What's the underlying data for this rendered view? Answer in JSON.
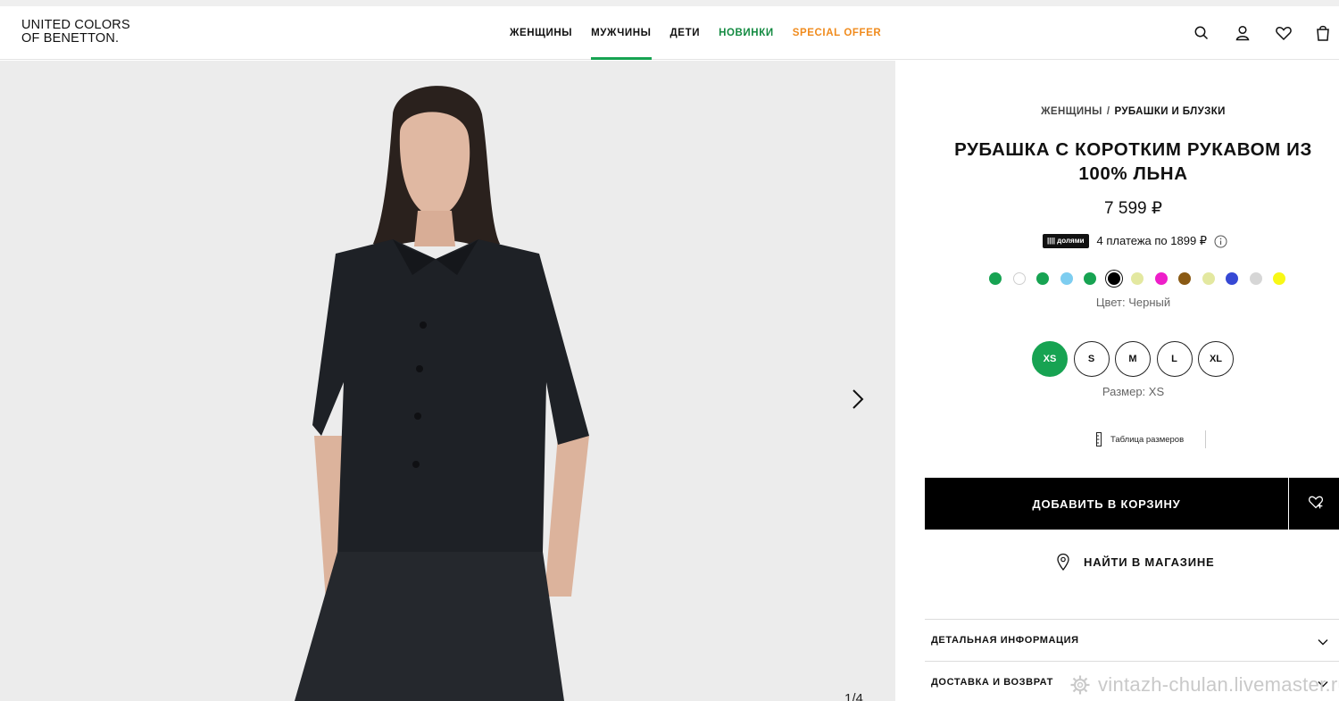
{
  "brand": {
    "line1": "UNITED COLORS",
    "line2": "OF BENETTON."
  },
  "nav": [
    {
      "label": "ЖЕНЩИНЫ",
      "style": "default"
    },
    {
      "label": "МУЖЧИНЫ",
      "style": "active"
    },
    {
      "label": "ДЕТИ",
      "style": "default"
    },
    {
      "label": "НОВИНКИ",
      "style": "green"
    },
    {
      "label": "SPECIAL OFFER",
      "style": "orange"
    }
  ],
  "header_icons": [
    "search-icon",
    "user-icon",
    "heart-icon",
    "bag-icon"
  ],
  "gallery": {
    "counter": "1/4"
  },
  "product": {
    "breadcrumb": {
      "parent": "ЖЕНЩИНЫ",
      "separator": "/",
      "current": "РУБАШКИ И БЛУЗКИ"
    },
    "title": "РУБАШКА С КОРОТКИМ РУКАВОМ ИЗ 100% ЛЬНА",
    "price": "7 599 ₽",
    "installments": {
      "badge": "|||| долями",
      "text": "4 платежа по 1899 ₽"
    },
    "colors": [
      {
        "hex": "#17a352"
      },
      {
        "hex": "#ffffff"
      },
      {
        "hex": "#17a352"
      },
      {
        "hex": "#7dcdf0"
      },
      {
        "hex": "#17a352"
      },
      {
        "hex": "#000000",
        "selected": true
      },
      {
        "hex": "#e3e8a0"
      },
      {
        "hex": "#ee1ec9"
      },
      {
        "hex": "#8a5a14"
      },
      {
        "hex": "#e3e8a0"
      },
      {
        "hex": "#3648d4"
      },
      {
        "hex": "#d6d6d6"
      },
      {
        "hex": "#f8f816"
      }
    ],
    "color_label": "Цвет: Черный",
    "sizes": [
      "XS",
      "S",
      "M",
      "L",
      "XL"
    ],
    "selected_size": "XS",
    "size_label": "Размер: XS",
    "size_chart": "Таблица размеров",
    "add_to_cart": "ДОБАВИТЬ В КОРЗИНУ",
    "find_in_store": "НАЙТИ В МАГАЗИНЕ",
    "accordions": [
      "ДЕТАЛЬНАЯ ИНФОРМАЦИЯ",
      "ДОСТАВКА И ВОЗВРАТ"
    ]
  },
  "accent_colors": {
    "green": "#17a352",
    "orange": "#f08b1d"
  },
  "watermark": "vintazh-chulan.livemaster.ru"
}
